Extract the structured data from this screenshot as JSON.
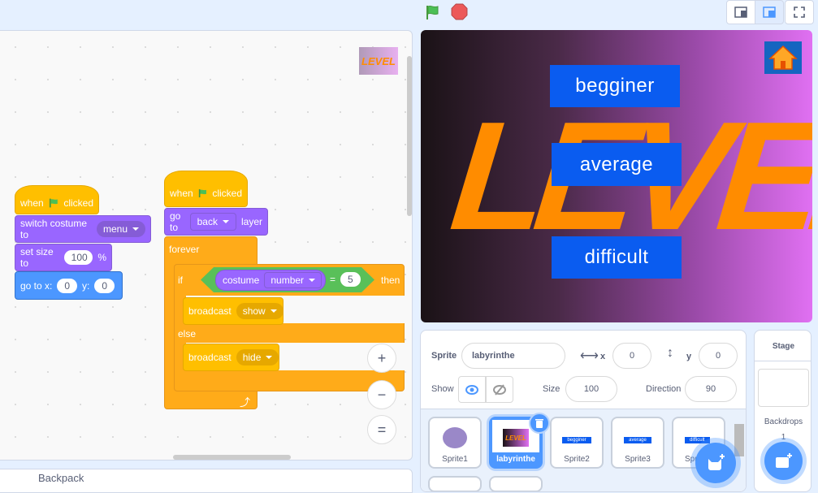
{
  "topbar": {
    "green_flag": "green-flag-icon",
    "stop": "stop-icon"
  },
  "code": {
    "script1": {
      "hat_when": "when",
      "hat_clicked": "clicked",
      "switch_label": "switch costume to",
      "costume": "menu",
      "size_label": "set size to",
      "size_value": "100",
      "size_unit": "%",
      "goto_label": "go to x:",
      "x": "0",
      "y_label": "y:",
      "y": "0"
    },
    "script2": {
      "hat_when": "when",
      "hat_clicked": "clicked",
      "goto_label": "go to",
      "layer_value": "back",
      "layer_label": "layer",
      "forever": "forever",
      "if": "if",
      "costume_label": "costume",
      "costume_prop": "number",
      "equals": "=",
      "compare_value": "5",
      "then": "then",
      "broadcast1_label": "broadcast",
      "broadcast1_value": "show",
      "else": "else",
      "broadcast2_label": "broadcast",
      "broadcast2_value": "hide"
    },
    "zoom_in": "+",
    "zoom_out": "−",
    "zoom_reset": "="
  },
  "backpack": {
    "label": "Backpack"
  },
  "stage": {
    "logo_text": "LEVEL",
    "buttons": [
      "begginer",
      "average",
      "difficult"
    ],
    "home": "home-icon"
  },
  "sprite_info": {
    "sprite_label": "Sprite",
    "sprite_name": "labyrinthe",
    "x_label": "x",
    "x": "0",
    "y_label": "y",
    "y": "0",
    "show_label": "Show",
    "size_label": "Size",
    "size": "100",
    "direction_label": "Direction",
    "direction": "90"
  },
  "sprites": [
    {
      "name": "Sprite1"
    },
    {
      "name": "labyrinthe",
      "selected": true,
      "thumb": "LEVEL"
    },
    {
      "name": "Sprite2",
      "thumb": "begginer"
    },
    {
      "name": "Sprite3",
      "thumb": "average"
    },
    {
      "name": "Sprite4",
      "thumb": "difficult"
    }
  ],
  "stage_panel": {
    "title": "Stage",
    "backdrops_label": "Backdrops",
    "backdrops_count": "1"
  },
  "colors": {
    "accent": "#4c97ff",
    "events": "#ffbf00",
    "looks": "#9966ff",
    "motion": "#4c97ff",
    "control": "#ffab19",
    "operators": "#59c059",
    "stage_button": "#0a5cf0",
    "logo": "#ff8c00"
  }
}
